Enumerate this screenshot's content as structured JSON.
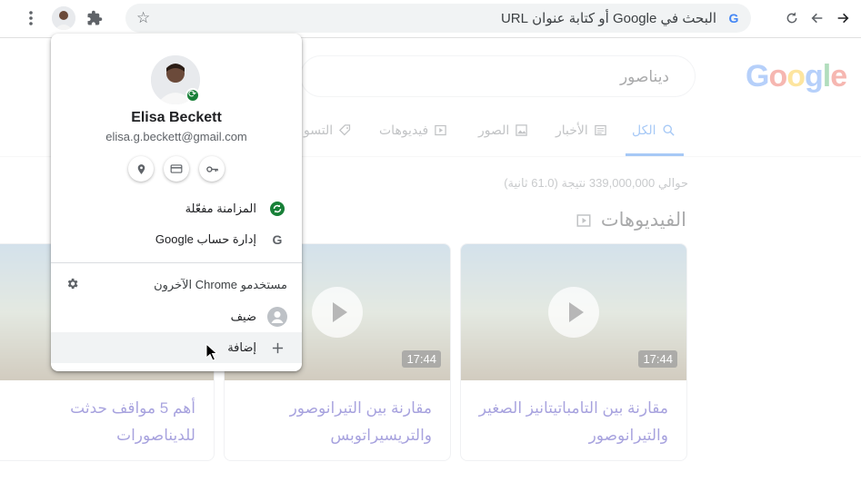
{
  "toolbar": {
    "omnibox_placeholder": "البحث في Google أو كتابة عنوان URL",
    "omnibox_g": "G"
  },
  "search_page": {
    "logo": [
      "G",
      "o",
      "o",
      "g",
      "l",
      "e"
    ],
    "logo_colors": [
      "#4285f4",
      "#ea4335",
      "#fbbc05",
      "#4285f4",
      "#34a853",
      "#ea4335"
    ],
    "query": "ديناصور",
    "tabs": [
      {
        "label": "الكل"
      },
      {
        "label": "الأخبار"
      },
      {
        "label": "الصور"
      },
      {
        "label": "فيديوهات"
      },
      {
        "label": "التسو"
      }
    ],
    "result_count": "حوالي 339,000,000 نتيجة (61.0 ثانية)",
    "videos_heading": "الفيديوهات",
    "videos": [
      {
        "duration": "17:44",
        "title": "مقارنة بين التامباتيتانيز الصغير والتيرانوصور"
      },
      {
        "duration": "17:44",
        "title": "مقارنة بين التيرانوصور والتريسيراتوبس"
      },
      {
        "duration": "",
        "title": "أهم 5 مواقف حدثت للديناصورات"
      }
    ]
  },
  "profile_popup": {
    "name": "Elisa Beckett",
    "email": "elisa.g.beckett@gmail.com",
    "sync_label": "المزامنة مفعّلة",
    "manage_account_label": "إدارة حساب Google",
    "other_users_label": "مستخدمو Chrome الآخرون",
    "guest_label": "ضيف",
    "add_label": "إضافة"
  },
  "colors": {
    "accent": "#1a73e8",
    "sync_green": "#188038",
    "link": "#1a0dab"
  }
}
